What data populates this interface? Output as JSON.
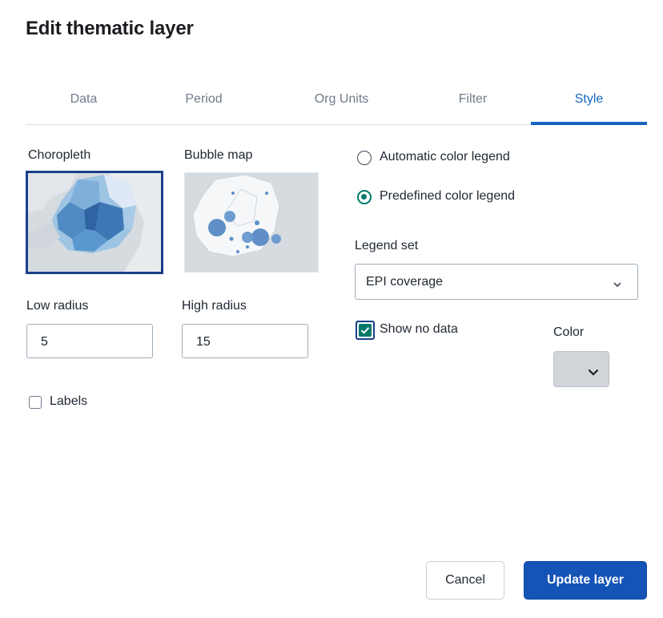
{
  "dialog": {
    "title": "Edit thematic layer"
  },
  "tabs": [
    {
      "label": "Data",
      "active": false
    },
    {
      "label": "Period",
      "active": false
    },
    {
      "label": "Org Units",
      "active": false
    },
    {
      "label": "Filter",
      "active": false
    },
    {
      "label": "Style",
      "active": true
    }
  ],
  "style": {
    "map_types": [
      {
        "label": "Choropleth",
        "selected": true
      },
      {
        "label": "Bubble map",
        "selected": false
      }
    ],
    "low_radius": {
      "label": "Low radius",
      "value": "5"
    },
    "high_radius": {
      "label": "High radius",
      "value": "15"
    },
    "labels": {
      "label": "Labels",
      "checked": false
    },
    "legend_options": [
      {
        "label": "Automatic color legend",
        "selected": false
      },
      {
        "label": "Predefined color legend",
        "selected": true
      }
    ],
    "legend_set": {
      "label": "Legend set",
      "value": "EPI coverage"
    },
    "show_no_data": {
      "label": "Show no data",
      "checked": true
    },
    "color": {
      "label": "Color",
      "value_color": "#d1d5da"
    }
  },
  "actions": {
    "cancel": "Cancel",
    "update": "Update layer"
  },
  "colors": {
    "accent": "#1565c0",
    "primary_button": "#1554b7",
    "radio_selected": "#00796b",
    "selected_thumb_border": "#1a3f89"
  }
}
